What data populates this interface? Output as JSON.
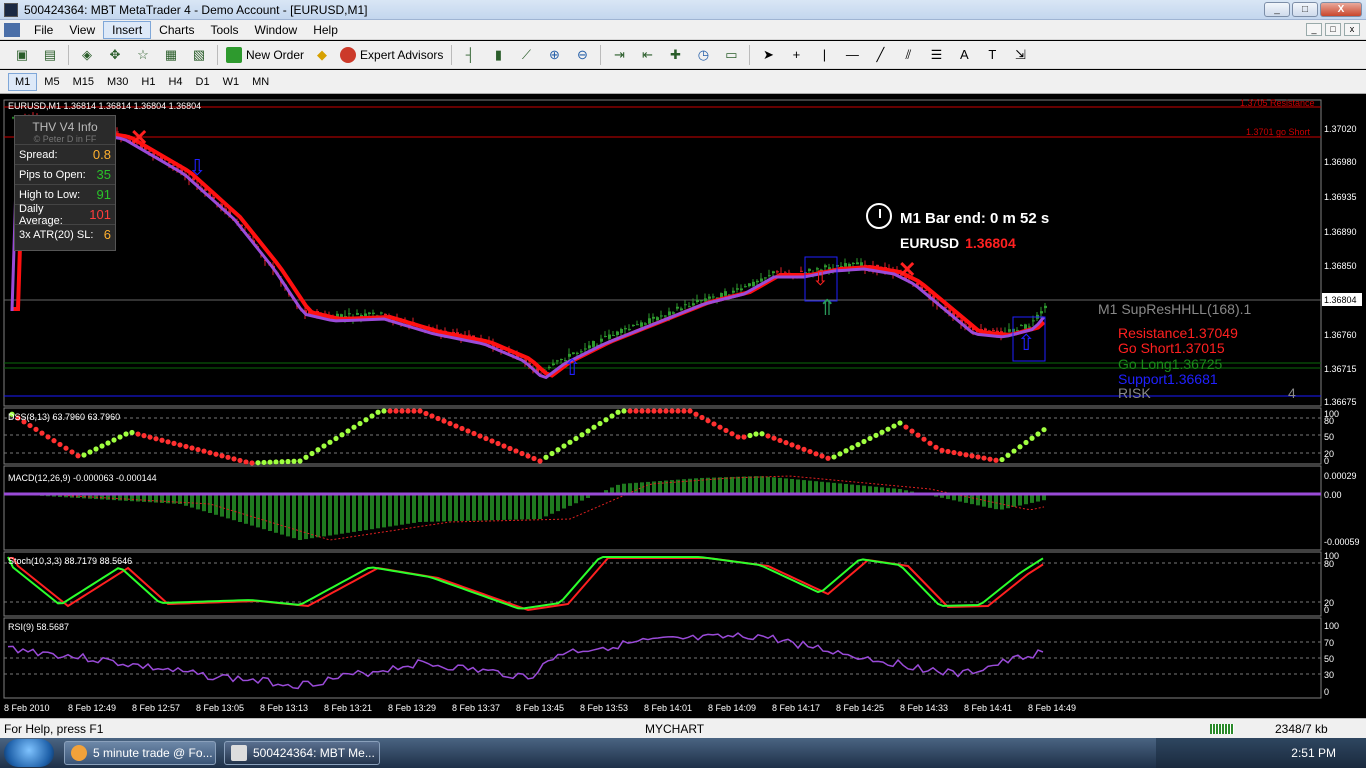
{
  "window": {
    "title": "500424364: MBT MetaTrader 4 - Demo Account - [EURUSD,M1]",
    "buttons": [
      "_",
      "□",
      "X"
    ]
  },
  "menu": [
    "File",
    "View",
    "Insert",
    "Charts",
    "Tools",
    "Window",
    "Help"
  ],
  "menu_active": "Insert",
  "toolbar": {
    "new_order": "New Order",
    "expert_advisors": "Expert Advisors"
  },
  "timeframes": [
    "M1",
    "M5",
    "M15",
    "M30",
    "H1",
    "H4",
    "D1",
    "W1",
    "MN"
  ],
  "timeframe_active": "M1",
  "chart": {
    "header": "EURUSD,M1  1.36814 1.36814 1.36804 1.36804",
    "bar_end_label": "M1 Bar end: 0 m 52 s",
    "symbol": "EURUSD",
    "price": "1.36804",
    "resistance_label": "1.3705 Resistance",
    "go_short_label": "1.3701 go Short",
    "supres_label": "M1 SupResHHLL(168).1",
    "legend": {
      "resistance": "Resistance1.37049",
      "go_short": "Go Short1.37015",
      "go_long": "Go Long1.36725",
      "support": "Support1.36681",
      "risk": "RISK",
      "risk_val": "4"
    },
    "price_axis": [
      "1.37020",
      "1.36980",
      "1.36935",
      "1.36890",
      "1.36850",
      "1.36804",
      "1.36760",
      "1.36715",
      "1.36675"
    ],
    "current_price": "1.36804",
    "time_axis": [
      "8 Feb 2010",
      "8 Feb 12:49",
      "8 Feb 12:57",
      "8 Feb 13:05",
      "8 Feb 13:13",
      "8 Feb 13:21",
      "8 Feb 13:29",
      "8 Feb 13:37",
      "8 Feb 13:45",
      "8 Feb 13:53",
      "8 Feb 14:01",
      "8 Feb 14:09",
      "8 Feb 14:17",
      "8 Feb 14:25",
      "8 Feb 14:33",
      "8 Feb 14:41",
      "8 Feb 14:49"
    ],
    "dss_label": "DSS(8,13) 63.7960 63.7960",
    "dss_axis": [
      "100",
      "80",
      "50",
      "20",
      "0"
    ],
    "macd_label": "MACD(12,26,9) -0.000063 -0.000144",
    "macd_axis": [
      "0.00029",
      "0.00",
      "-0.00059"
    ],
    "stoch_label": "Stoch(10,3,3) 88.7179 88.5646",
    "stoch_axis": [
      "100",
      "80",
      "20",
      "0"
    ],
    "rsi_label": "RSI(9) 58.5687",
    "rsi_axis": [
      "100",
      "70",
      "50",
      "30",
      "0"
    ]
  },
  "thv_panel": {
    "title": "THV  V4  Info",
    "credit": "© Peter D in FF",
    "rows": [
      {
        "label": "Spread:",
        "value": "0.8",
        "color": "#ffb02e"
      },
      {
        "label": "Pips to Open:",
        "value": "35",
        "color": "#29c229"
      },
      {
        "label": "High to Low:",
        "value": "91",
        "color": "#29c229"
      },
      {
        "label": "Daily Average:",
        "value": "101",
        "color": "#ff3c3c"
      },
      {
        "label": "3x ATR(20) SL:",
        "value": "6",
        "color": "#ffb02e"
      }
    ]
  },
  "status": {
    "help": "For Help, press F1",
    "profile": "MYCHART",
    "traffic": "2348/7 kb"
  },
  "taskbar": {
    "tasks": [
      "5 minute trade @ Fo...",
      "500424364: MBT Me..."
    ],
    "clock": "2:51 PM"
  },
  "colors": {
    "candle_up": "#2e9a2e",
    "candle_down": "#e0202a",
    "ma_red": "#ff1010",
    "ma_purple": "#9a4bd8",
    "dss_dot_up": "#a0ff40",
    "dss_dot_down": "#ff3030",
    "macd_bar": "#1f7a1f",
    "stoch_green": "#2cff2c",
    "stoch_red": "#ff2020",
    "rsi": "#9a4bd8"
  }
}
